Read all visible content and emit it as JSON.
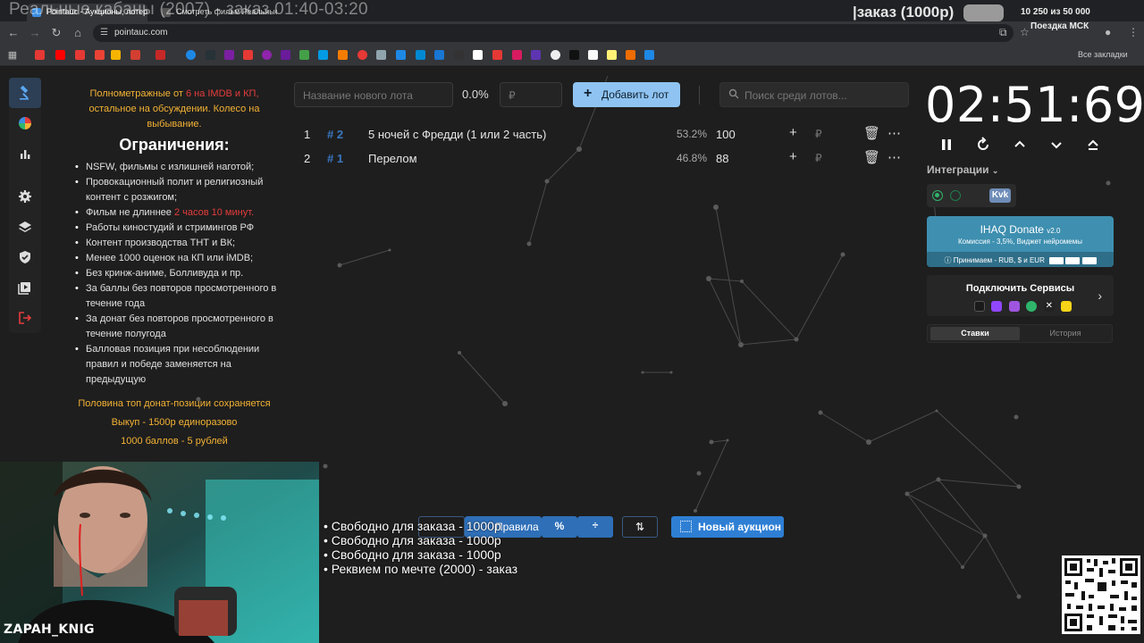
{
  "browser": {
    "tabs": [
      {
        "label": "Pointauc - Аукционы, лотереи",
        "active": true
      },
      {
        "label": "Смотреть фильм Реальные кабаны",
        "active": false
      }
    ],
    "url": "pointauc.com",
    "bookmarks_all": "Все закладки"
  },
  "stream_overlay": {
    "title": "Реальные кабаны (2007) - заказ 01:40-03:20",
    "order_label": "|заказ (1000р)",
    "goal_count": "10 250  из 50 000",
    "goal_name": "Поездка МСК",
    "streamer_name": "ZAPAH_KNIG",
    "queue": [
      "• Свободно для заказа - 1000р",
      "• Свободно для заказа - 1000р",
      "• Свободно для заказа - 1000р",
      "• Реквием по мечте (2000) - заказ"
    ]
  },
  "rules": {
    "intro_1": "Полнометражные от",
    "intro_red": "6 на IMDB и КП,",
    "intro_2": "остальное на обсуждении. Колесо на выбывание.",
    "heading": "Ограничения:",
    "items": [
      "NSFW, фильмы с излишней наготой;",
      "Провокационный полит и религиозный контент с розжигом;",
      "Фильм не длиннее",
      "Работы киностудий и стримингов РФ",
      "Контент производства ТНТ и ВК;",
      "Менее 1000 оценок на КП или iMDB;",
      "Без кринж-аниме, Болливуда и пр.",
      "За баллы без повторов просмотренного в течение года",
      "За донат без повторов просмотренного в течение полугода",
      "Балловая позиция при несоблюдении правил и победе заменяется на предыдущую"
    ],
    "duration_red": "2 часов 10 минут.",
    "foot": [
      "Половина топ донат-позиции сохраняется",
      "Выкуп - 1500р единоразово",
      "1000 баллов - 5 рублей"
    ]
  },
  "toolbar": {
    "lot_placeholder": "Название нового лота",
    "total_percent": "0.0%",
    "rub_placeholder": "₽",
    "add_label": "Добавить лот",
    "search_placeholder": "Поиск среди лотов..."
  },
  "lots": [
    {
      "index": "1",
      "id": "# 2",
      "name": "5 ночей с Фредди (1 или 2 часть)",
      "percent": "53.2%",
      "amount": "100"
    },
    {
      "index": "2",
      "id": "# 1",
      "name": "Перелом",
      "percent": "46.8%",
      "amount": "88"
    }
  ],
  "timer": "02:51:69",
  "integrations": {
    "label": "Интеграции",
    "vk": "Kvk"
  },
  "donate": {
    "title": "IHAQ Donate",
    "version": "v2.0",
    "commission": "Комиссия - 3,5%, Виджет нейромемы",
    "accepts": "Принимаем - RUB, $ и EUR"
  },
  "services": {
    "title": "Подключить Сервисы"
  },
  "bids_tabs": [
    "Ставки",
    "История"
  ],
  "bottom": {
    "rules_btn": "Правила",
    "new_auction": "Новый аукцион"
  },
  "colors": {
    "accent": "#8fc4f2",
    "orange": "#f3b234",
    "red": "#e53c3c",
    "donate": "#3e8fb0"
  }
}
